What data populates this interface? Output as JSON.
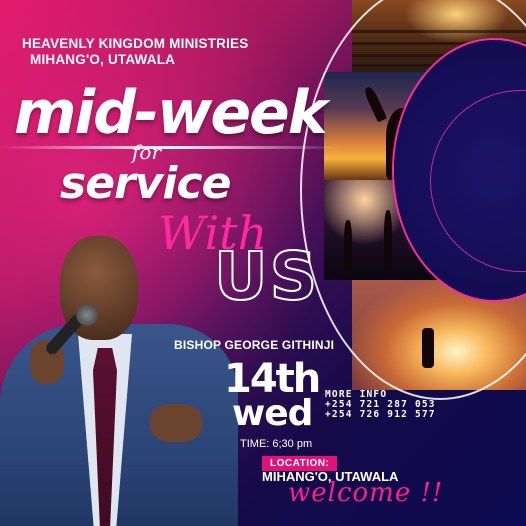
{
  "organization": {
    "name_line1": "HEAVENLY KINGDOM MINISTRIES",
    "name_line2": "MIHANG'O, UTAWALA"
  },
  "headline": {
    "main": "mid-week",
    "connector": "for",
    "sub": "service",
    "script": "With",
    "outline": "US"
  },
  "speaker": "BISHOP GEORGE GITHINJI",
  "date": {
    "day": "14th",
    "weekday": "wed",
    "time": "TIME: 6;30 pm"
  },
  "contact": {
    "label": "MORE INFO",
    "phone1": "+254 721 287 053",
    "phone2": "+254 726 912 577"
  },
  "location": {
    "label": "LOCATION:",
    "value": "MIHANG'O, UTAWALA"
  },
  "closing": "welcome !!",
  "colors": {
    "accent_pink": "#ff1e8c",
    "background_navy": "#140a48",
    "background_magenta": "#e21a6a"
  }
}
